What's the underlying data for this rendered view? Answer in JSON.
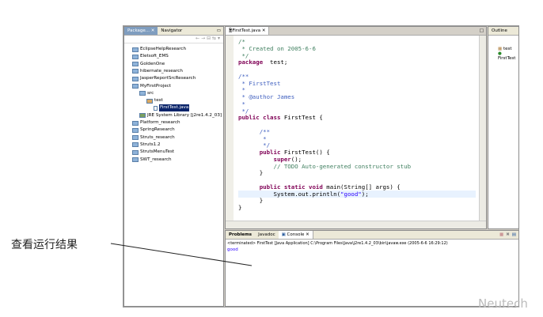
{
  "package_explorer": {
    "tabs": [
      "Package...",
      "Navigator"
    ],
    "items": [
      {
        "label": "EclipseHelpResearch",
        "depth": 0,
        "icon": "project-folder-icon"
      },
      {
        "label": "Eletsoft_EMS",
        "depth": 0,
        "icon": "project-folder-icon"
      },
      {
        "label": "GoldenOne",
        "depth": 0,
        "icon": "project-folder-icon"
      },
      {
        "label": "hibernate_research",
        "depth": 0,
        "icon": "project-folder-icon"
      },
      {
        "label": "JasperReportSrcResearch",
        "depth": 0,
        "icon": "project-folder-icon"
      },
      {
        "label": "MyFirstProject",
        "depth": 0,
        "icon": "open-project-icon"
      },
      {
        "label": "src",
        "depth": 1,
        "icon": "source-folder-icon"
      },
      {
        "label": "test",
        "depth": 2,
        "icon": "package-icon"
      },
      {
        "label": "FirstTest.java",
        "depth": 3,
        "icon": "java-file-icon",
        "selected": true
      },
      {
        "label": "JRE System Library [j2re1.4.2_03]",
        "depth": 1,
        "icon": "library-icon"
      },
      {
        "label": "Platform_research",
        "depth": 0,
        "icon": "project-folder-icon"
      },
      {
        "label": "SpringResearch",
        "depth": 0,
        "icon": "project-folder-icon"
      },
      {
        "label": "Struts_research",
        "depth": 0,
        "icon": "project-folder-icon"
      },
      {
        "label": "Struts1.2",
        "depth": 0,
        "icon": "project-folder-icon"
      },
      {
        "label": "StrutsMenuTest",
        "depth": 0,
        "icon": "project-folder-icon"
      },
      {
        "label": "SWT_research",
        "depth": 0,
        "icon": "project-folder-icon"
      }
    ]
  },
  "editor": {
    "tab": "FirstTest.java",
    "lines": [
      [
        [
          "cm",
          "/*"
        ]
      ],
      [
        [
          "cm",
          " * Created on 2005-6-6"
        ]
      ],
      [
        [
          "cm",
          " */"
        ]
      ],
      [
        [
          "kw",
          "package"
        ],
        [
          "",
          "  test;"
        ]
      ],
      [],
      [
        [
          "jd",
          "/**"
        ]
      ],
      [
        [
          "jd",
          " * FirstTest"
        ]
      ],
      [
        [
          "jd",
          " *"
        ]
      ],
      [
        [
          "jd",
          " * @author James"
        ]
      ],
      [
        [
          "jd",
          " *"
        ]
      ],
      [
        [
          "jd",
          " */"
        ]
      ],
      [
        [
          "kw",
          "public class"
        ],
        [
          "",
          " FirstTest {"
        ]
      ],
      [],
      [
        [
          "jd",
          "      /**"
        ]
      ],
      [
        [
          "jd",
          "       *"
        ]
      ],
      [
        [
          "jd",
          "       */"
        ]
      ],
      [
        [
          "kw",
          "      public"
        ],
        [
          "",
          " FirstTest() {"
        ]
      ],
      [
        [
          "kw",
          "          super"
        ],
        [
          "",
          "();"
        ]
      ],
      [
        [
          "cm",
          "          // TODO Auto-generated constructor stub"
        ]
      ],
      [
        [
          "",
          "      }"
        ]
      ],
      [],
      [
        [
          "kw",
          "      public static void"
        ],
        [
          "",
          " main(String[] args) {"
        ]
      ],
      [
        [
          "",
          "          System.out.println("
        ],
        [
          "st",
          "\"good\""
        ],
        [
          "",
          ");"
        ]
      ],
      [
        [
          "",
          "      }"
        ]
      ],
      [
        [
          "",
          "}"
        ]
      ]
    ]
  },
  "outline": {
    "tab": "Outline",
    "items": [
      "test",
      "FirstTest"
    ]
  },
  "console": {
    "tabs": [
      "Problems",
      "Javadoc",
      "Console"
    ],
    "status": "<terminated> FirstTest [Java Application] C:\\Program Files\\Java\\j2re1.4.2_03\\bin\\javaw.exe (2005-6-6 16:29:12)",
    "output": "good"
  },
  "annotation": {
    "label": "查看运行结果"
  },
  "watermark": "Neutech"
}
